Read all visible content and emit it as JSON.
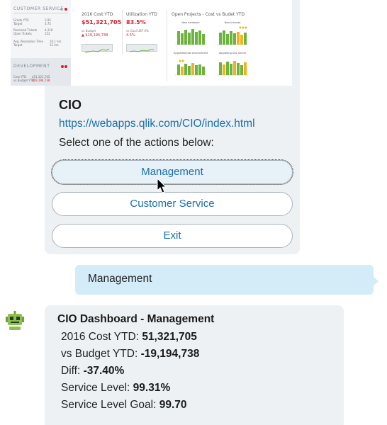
{
  "card": {
    "title": "CIO",
    "url": "https://webapps.qlik.com/CIO/index.html",
    "prompt": "Select one of the actions below:",
    "buttons": {
      "management": "Management",
      "customer_service": "Customer Service",
      "exit": "Exit"
    }
  },
  "thumbnail": {
    "customer_service_title": "CUSTOMER SERVICE",
    "cs_rows": [
      {
        "label": "Grade YTD",
        "value": "3.95"
      },
      {
        "label": "Target",
        "value": "3.75"
      },
      {
        "label": "Resolved Tickets",
        "value": "4,218"
      },
      {
        "label": "Open Tickets",
        "value": "152"
      },
      {
        "label": "Avg. Resolution Time",
        "value": "10.1 hrs"
      },
      {
        "label": "Target",
        "value": "12 hrs"
      }
    ],
    "development_title": "DEVELOPMENT",
    "dev_rows": [
      {
        "label": "Cost YTD",
        "value": "$51,321,705"
      },
      {
        "label": "vs Budget YTD",
        "value": "$19,194,738"
      }
    ],
    "kpi_cost_title": "2016 Cost YTD",
    "kpi_cost_value": "$51,321,705",
    "kpi_cost_sub": "vs Budget",
    "kpi_cost_diff": "▲ $19,194,738",
    "kpi_util_title": "Utilization YTD",
    "kpi_util_value": "83.5%",
    "kpi_util_sub": "vs Goal UBT 0%",
    "kpi_util_diff": "4.5%",
    "projects_title": "Open Projects - Cost vs Budet YTD",
    "mini_titles": [
      "New hardware",
      "New Intranet",
      "Upgraded test environment",
      "Upgrading SQL Server"
    ],
    "colors": {
      "green": "#6cb33f",
      "yellow": "#f2b21b",
      "red": "#d71d2a"
    }
  },
  "user_message": "Management",
  "bot": {
    "title": "CIO Dashboard - Management",
    "lines": [
      {
        "label": "2016 Cost YTD: ",
        "value": "51,321,705"
      },
      {
        "label": "vs Budget YTD: ",
        "value": "-19,194,738"
      },
      {
        "label": "Diff: ",
        "value": "-37.40%"
      },
      {
        "label": "Service Level: ",
        "value": "99.31%"
      },
      {
        "label": "Service Level Goal: ",
        "value": "99.70"
      }
    ]
  }
}
